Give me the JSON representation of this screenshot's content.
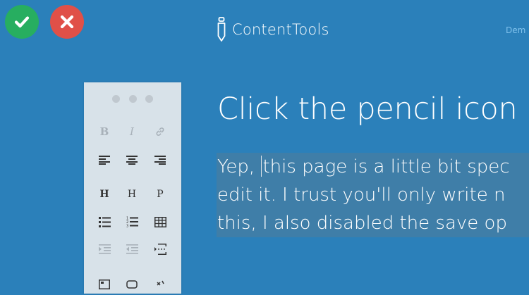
{
  "app": {
    "name": "ContentTools",
    "confirm_icon": "check-icon",
    "cancel_icon": "close-icon",
    "logo_icon": "pencil-icon"
  },
  "nav": {
    "link_label": "Dem"
  },
  "colors": {
    "background": "#2b80ba",
    "confirm": "#27ae60",
    "cancel": "#e05048",
    "toolbox": "#d8e2e9",
    "selection": "#3f7ea8"
  },
  "toolbox": {
    "tools": [
      {
        "name": "bold",
        "label": "B",
        "enabled": false
      },
      {
        "name": "italic",
        "label": "I",
        "enabled": false
      },
      {
        "name": "link",
        "icon": "link-icon",
        "enabled": false
      },
      {
        "name": "align-left",
        "icon": "align-left-icon",
        "enabled": true
      },
      {
        "name": "align-center",
        "icon": "align-center-icon",
        "enabled": true
      },
      {
        "name": "align-right",
        "icon": "align-right-icon",
        "enabled": true
      },
      {
        "name": "heading",
        "label": "H",
        "enabled": true
      },
      {
        "name": "subheading",
        "label": "H",
        "enabled": true
      },
      {
        "name": "paragraph",
        "label": "P",
        "enabled": true
      },
      {
        "name": "unordered-list",
        "icon": "bullet-list-icon",
        "enabled": true
      },
      {
        "name": "ordered-list",
        "icon": "numbered-list-icon",
        "enabled": true
      },
      {
        "name": "table",
        "icon": "table-icon",
        "enabled": true
      },
      {
        "name": "indent",
        "icon": "indent-icon",
        "enabled": false
      },
      {
        "name": "unindent",
        "icon": "outdent-icon",
        "enabled": false
      },
      {
        "name": "line-break",
        "icon": "line-break-icon",
        "enabled": true
      }
    ]
  },
  "content": {
    "heading": "Click the pencil icon",
    "paragraph_lines": [
      {
        "before_caret": "Yep, ",
        "after_caret": "this page is a little bit spec"
      },
      {
        "text": "edit it. I trust you'll only write n"
      },
      {
        "text": "this, I also disabled the save op"
      }
    ]
  }
}
